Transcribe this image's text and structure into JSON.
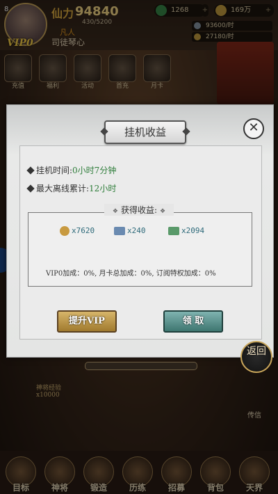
{
  "player": {
    "level": "8",
    "vip": "VIP0",
    "power_label": "仙力",
    "power": "94840",
    "exp": "430/5200",
    "rank": "凡人",
    "name": "司徒琴心"
  },
  "resources": {
    "jade": "1268",
    "coins": "169万",
    "rate_1": "93600/时",
    "rate_2": "27180/时"
  },
  "top_icons": [
    "充值",
    "福利",
    "活动",
    "首充",
    "月卡"
  ],
  "dialog": {
    "title": "挂机收益",
    "close_icon": "close-icon",
    "idle_time_label": "挂机时间:",
    "idle_time_value": "0小时7分钟",
    "max_offline_label": "最大离线累计:",
    "max_offline_value": "12小时",
    "rewards_title": "获得收益:",
    "rewards": [
      {
        "icon": "coin-icon",
        "amount": "x7620"
      },
      {
        "icon": "blue-scroll-icon",
        "amount": "x240"
      },
      {
        "icon": "green-scroll-icon",
        "amount": "x2094"
      }
    ],
    "bonus_text": "VIP0加成：0%, 月卡总加成：0%, 订阅特权加成：0%",
    "upgrade_vip_button": "提升VIP",
    "claim_button": "领 取"
  },
  "back_button": "返回",
  "side_text": "神将经验x10000",
  "side_tag": "传信",
  "bottom_nav": [
    "目标",
    "神将",
    "锻造",
    "历练",
    "招募",
    "背包",
    "天界"
  ],
  "colors": {
    "accent_green": "#2e7d3a",
    "gold": "#ffd54a",
    "reward_text": "#2e6a7a"
  }
}
